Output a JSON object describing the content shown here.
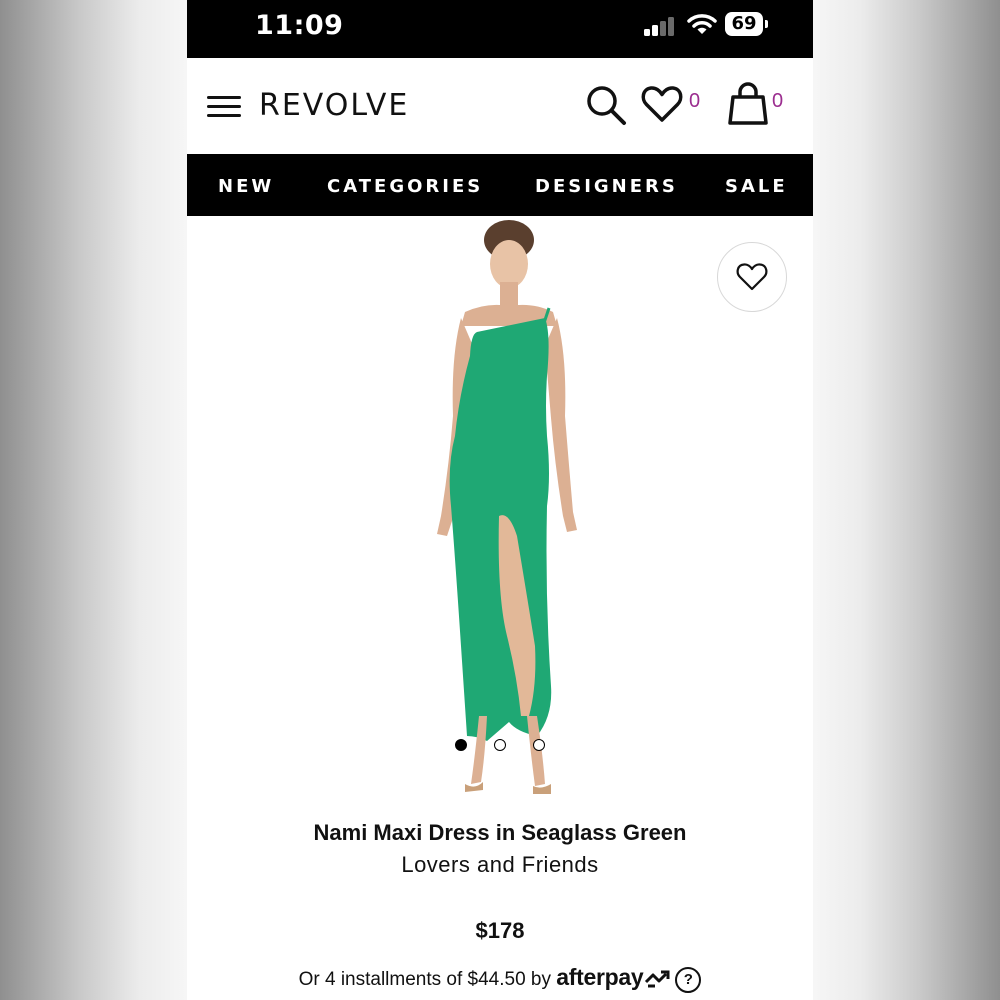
{
  "status_bar": {
    "time": "11:09",
    "battery": "69"
  },
  "header": {
    "logo": "REVOLVE",
    "wishlist_count": "0",
    "bag_count": "0",
    "badge_color": "#9b2d8f"
  },
  "nav": {
    "items": [
      "NEW",
      "CATEGORIES",
      "DESIGNERS",
      "SALE"
    ]
  },
  "gallery": {
    "image_count": 3,
    "active_index": 0,
    "dress_color": "#1fa874"
  },
  "product": {
    "title": "Nami Maxi Dress in Seaglass Green",
    "brand": "Lovers and Friends",
    "price": "$178",
    "installments_text": "Or 4 installments of $44.50 by",
    "afterpay_label": "afterpay",
    "info_symbol": "?"
  }
}
